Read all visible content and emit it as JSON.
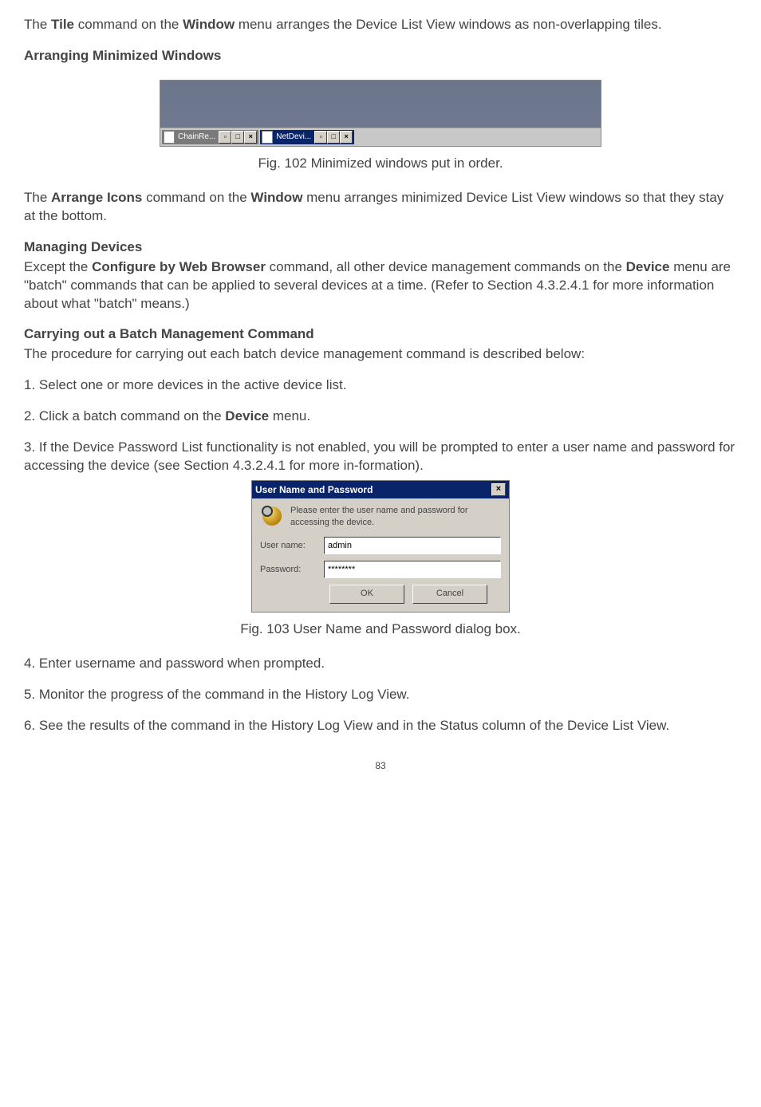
{
  "para1_pre": "The ",
  "para1_b1": "Tile",
  "para1_mid": " command on the ",
  "para1_b2": "Window",
  "para1_post": " menu arranges the Device List View windows as non-overlapping tiles.",
  "heading_arranging": "Arranging Minimized Windows",
  "fig102": {
    "task1_title": "ChainRe...",
    "task2_title": "NetDevi...",
    "restore": "▫",
    "max": "□",
    "close": "×"
  },
  "fig102_caption": "Fig. 102 Minimized windows put in order.",
  "para2_pre": "The ",
  "para2_b1": "Arrange Icons",
  "para2_mid": " command on the ",
  "para2_b2": "Window",
  "para2_post": " menu arranges minimized Device List View windows so that they stay at the bottom.",
  "heading_managing": "Managing Devices",
  "para3_pre": "Except the ",
  "para3_b1": "Configure by Web Browser",
  "para3_mid": " command, all other device management commands on the ",
  "para3_b2": "Device",
  "para3_post": " menu are \"batch\" commands that can be applied to several devices at a time. (Refer to Section 4.3.2.4.1 for more information about what \"batch\" means.)",
  "heading_batch": "Carrying out a Batch Management Command",
  "para4": "The procedure for carrying out each batch device management command is described below:",
  "step1": "1. Select one or more devices in the active device list.",
  "step2_pre": "2. Click a batch command on the ",
  "step2_b": "Device",
  "step2_post": " menu.",
  "step3": "3. If the Device Password List functionality is not enabled, you will be prompted to enter a user name and password for accessing the device (see Section 4.3.2.4.1 for more in-formation).",
  "dialog": {
    "title": "User Name and Password",
    "close": "×",
    "message": "Please enter the user name and password for accessing the device.",
    "user_label": "User name:",
    "user_value": "admin",
    "pass_label": "Password:",
    "pass_value": "********",
    "ok": "OK",
    "cancel": "Cancel"
  },
  "fig103_caption": "Fig. 103 User Name and Password dialog box.",
  "step4": "4. Enter username and password when prompted.",
  "step5": "5. Monitor the progress of the command in the History Log View.",
  "step6": "6. See the results of the command in the History Log View and in the Status column of the Device List View.",
  "page_number": "83"
}
